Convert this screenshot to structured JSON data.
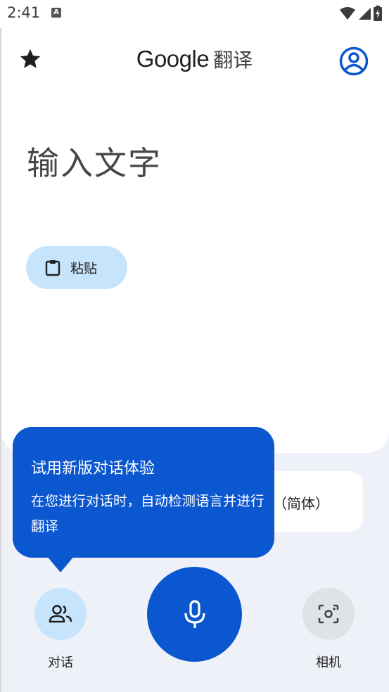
{
  "status_bar": {
    "time": "2:41",
    "notification_icon_letter": "A",
    "icons": [
      "wifi-icon",
      "signal-icon",
      "battery-charging-icon"
    ]
  },
  "header": {
    "brand": "Google",
    "title_suffix": "翻译",
    "left_icon": "star-icon",
    "right_icon": "account-icon"
  },
  "input": {
    "placeholder": "输入文字"
  },
  "paste_button": {
    "label": "粘贴",
    "icon": "clipboard-icon"
  },
  "language": {
    "target_visible_text": "文（简体）"
  },
  "tooltip": {
    "title": "试用新版对话体验",
    "body": "在您进行对话时，自动检测语言并进行翻译"
  },
  "bottom_actions": {
    "conversation_label": "对话",
    "camera_label": "相机",
    "mic_icon": "microphone-icon"
  },
  "colors": {
    "accent": "#0b57d0",
    "chip": "#c6e4fb",
    "background": "#eef1f7",
    "surface": "#ffffff",
    "camera_bg": "#dfe2e7"
  }
}
